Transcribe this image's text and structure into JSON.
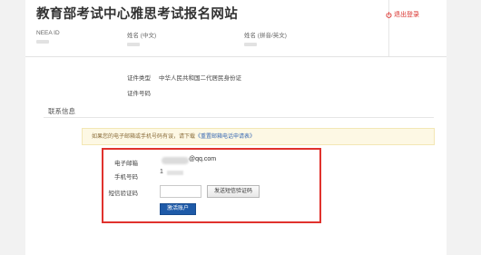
{
  "header": {
    "site_title": "教育部考试中心雅思考试报名网站",
    "logout_label": "退出登录"
  },
  "profile": {
    "neea_id_label": "NEEA ID",
    "name_cn_label": "姓名 (中文)",
    "name_pinyin_label": "姓名 (拼音/英文)"
  },
  "identity": {
    "id_type_label": "证件类型",
    "id_type_value": "中华人民共和国二代居民身份证",
    "id_number_label": "证件号码"
  },
  "contact": {
    "section_title": "联系信息",
    "notice_text": "如果您的电子邮箱或手机号码有误，请下载",
    "notice_link": "《重置邮箱电话申请表》",
    "email_label": "电子邮箱",
    "email_suffix": "@qq.com",
    "phone_label": "手机号码",
    "phone_prefix": "1",
    "sms_label": "短信验证码",
    "sms_value": "",
    "send_sms_button": "发送短信验证码",
    "activate_button": "激活账户"
  },
  "colors": {
    "accent": "#1e5aa8",
    "logout": "#d9302c",
    "highlight_box": "#e0322d",
    "notice_bg": "#fdf8e4"
  }
}
